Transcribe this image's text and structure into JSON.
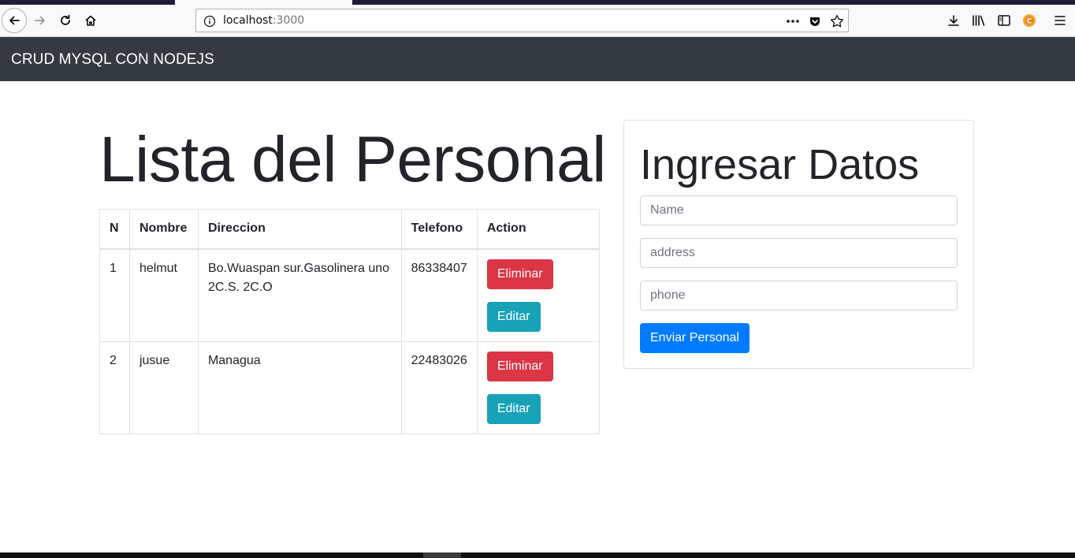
{
  "browser": {
    "url_host": "localhost",
    "url_port": ":3000",
    "icons": [
      "back-icon",
      "forward-icon",
      "reload-icon",
      "home-icon",
      "info-icon",
      "page-actions-icon",
      "pocket-icon",
      "bookmark-star-icon",
      "download-icon",
      "library-icon",
      "sidebar-icon",
      "extension-icon",
      "menu-icon"
    ]
  },
  "navbar": {
    "brand": "CRUD MYSQL CON NODEJS",
    "background": "#343a40"
  },
  "list": {
    "title": "Lista del Personal",
    "columns": [
      "N",
      "Nombre",
      "Direccion",
      "Telefono",
      "Action"
    ],
    "rows": [
      {
        "n": "1",
        "nombre": "helmut",
        "direccion": "Bo.Wuaspan sur.Gasolinera uno 2C.S. 2C.O",
        "telefono": "86338407",
        "delete": "Eliminar",
        "edit": "Editar"
      },
      {
        "n": "2",
        "nombre": "jusue",
        "direccion": "Managua",
        "telefono": "22483026",
        "delete": "Eliminar",
        "edit": "Editar"
      }
    ]
  },
  "form": {
    "title": "Ingresar Datos",
    "name_placeholder": "Name",
    "address_placeholder": "address",
    "phone_placeholder": "phone",
    "submit_label": "Enviar Personal"
  },
  "colors": {
    "danger": "#dc3545",
    "info": "#17a2b8",
    "primary": "#007bff"
  }
}
